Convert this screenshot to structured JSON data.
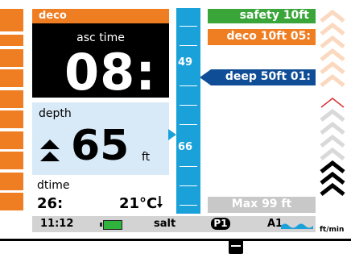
{
  "deco_header": "deco",
  "asc": {
    "label": "asc time",
    "value": "08:"
  },
  "depth": {
    "label": "depth",
    "value": "65",
    "unit": "ft"
  },
  "dtime": {
    "label": "dtime",
    "value": "26:"
  },
  "temperature": "21°C",
  "depth_bar": {
    "upper_label": "49",
    "lower_label": "66"
  },
  "badges": {
    "safety": "safety 10ft",
    "deco": "deco 10ft 05:",
    "deep": "deep 50ft 01:",
    "max": "Max 99 ft"
  },
  "status": {
    "time": "11:12",
    "water": "salt",
    "profile": "P1",
    "algorithm": "A1",
    "rate_unit": "ft/min"
  },
  "icons": {
    "battery": "battery-full-icon",
    "wave": "wave-icon",
    "ascent": "double-up-arrow-icon",
    "temp_trend": "down-arrow-icon"
  },
  "colors": {
    "orange": "#ef7d22",
    "blue_bar": "#1ba1da",
    "deep_blue": "#0f4e96",
    "green": "#3aa63a",
    "depth_panel": "#d8eaf7"
  }
}
